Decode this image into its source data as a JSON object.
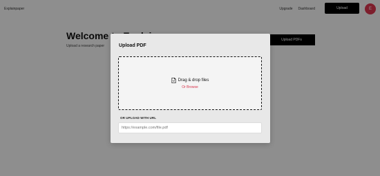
{
  "header": {
    "brand": "Explainpaper",
    "nav": [
      "Upgrade",
      "Dashboard"
    ],
    "upload_label": "Upload",
    "avatar_initial": "E"
  },
  "background": {
    "welcome_title": "Welcome to Explainpaper",
    "subtitle": "Upload a research paper",
    "upload_files_label": "Upload PDFs"
  },
  "modal": {
    "title": "Upload PDF",
    "dropzone_text": "Drag & drop files",
    "browse_text": "Or Browse",
    "url_label": "OR UPLOAD WITH URL",
    "url_placeholder": "https://example.com/file.pdf"
  },
  "colors": {
    "accent": "#d8344c",
    "overlay": "rgba(0,0,0,0.42)"
  }
}
